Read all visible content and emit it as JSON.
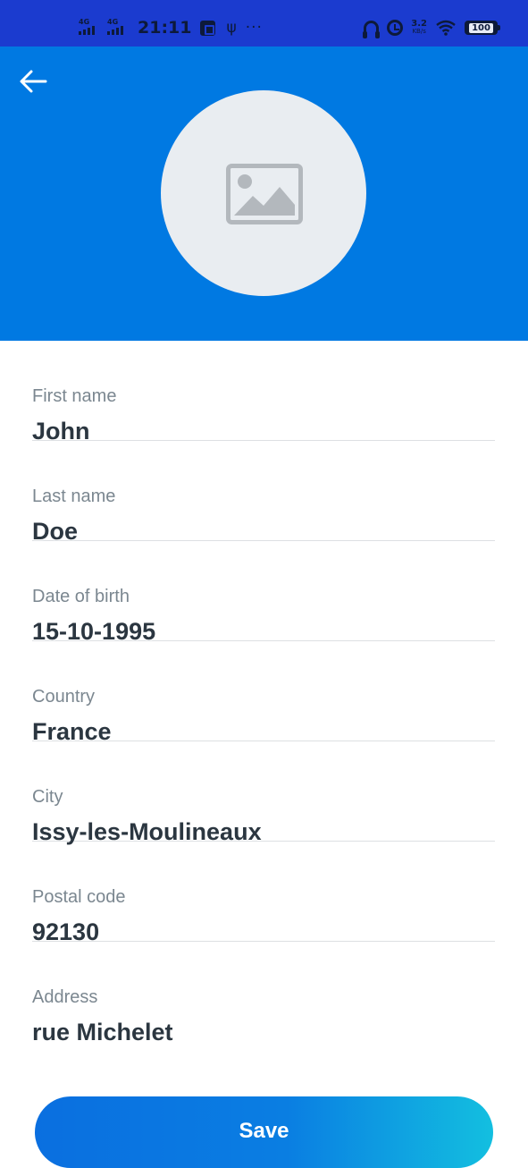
{
  "status_bar": {
    "network_1": "4G",
    "network_2": "4G",
    "time": "21:11",
    "speed_value": "3.2",
    "speed_unit": "KB/s",
    "battery": "100"
  },
  "header": {
    "background_color": "#0079e2",
    "back_icon": "arrow-left-icon",
    "avatar_icon": "image-placeholder-icon"
  },
  "form": {
    "fields": [
      {
        "label": "First name",
        "value": "John"
      },
      {
        "label": "Last name",
        "value": "Doe"
      },
      {
        "label": "Date of birth",
        "value": "15-10-1995"
      },
      {
        "label": "Country",
        "value": "France"
      },
      {
        "label": "City",
        "value": "Issy-les-Moulineaux"
      },
      {
        "label": "Postal code",
        "value": "92130"
      },
      {
        "label": "Address",
        "value": "rue Michelet"
      }
    ]
  },
  "actions": {
    "save_label": "Save"
  }
}
